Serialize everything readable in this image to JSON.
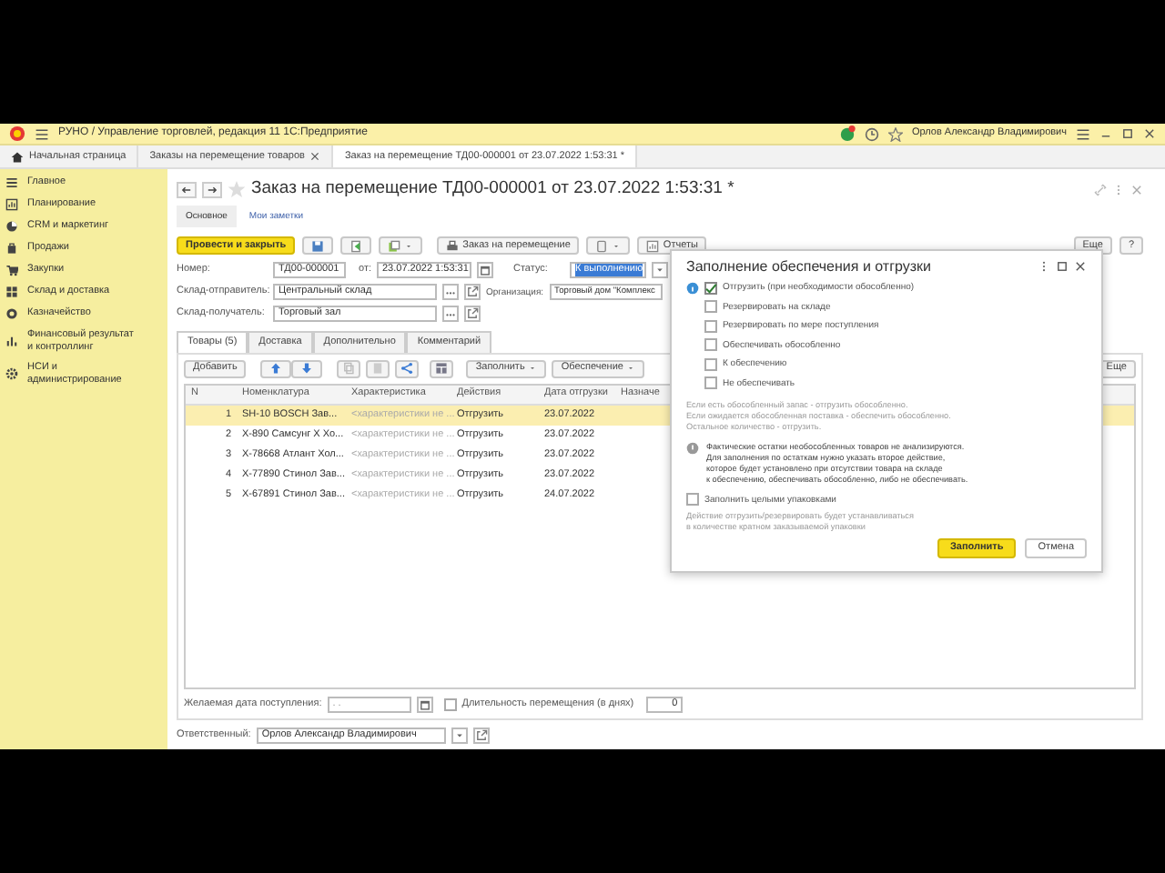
{
  "app_title": "РУНО / Управление торговлей, редакция 11 1С:Предприятие",
  "user": "Орлов Александр Владимирович",
  "tabs": [
    {
      "label": "Начальная страница",
      "kind": "home",
      "selected": false,
      "closable": false
    },
    {
      "label": "Заказы на перемещение товаров",
      "kind": "page",
      "selected": false,
      "closable": true
    },
    {
      "label": "Заказ на перемещение ТД00-000001 от 23.07.2022 1:53:31 *",
      "kind": "page",
      "selected": true,
      "closable": false
    }
  ],
  "sidebar": {
    "items": [
      {
        "label": "Главное"
      },
      {
        "label": "Планирование"
      },
      {
        "label": "CRM и маркетинг"
      },
      {
        "label": "Продажи"
      },
      {
        "label": "Закупки"
      },
      {
        "label": "Склад и доставка"
      },
      {
        "label": "Казначейство"
      },
      {
        "label": "Финансовый результат и контроллинг"
      },
      {
        "label": "НСИ и администрирование"
      }
    ]
  },
  "document": {
    "title": "Заказ на перемещение ТД00-000001 от 23.07.2022 1:53:31 *",
    "subtabs": [
      {
        "label": "Основное",
        "selected": true
      },
      {
        "label": "Мои заметки",
        "selected": false
      }
    ],
    "toolbar": {
      "post_button": "Провести и закрыть",
      "print_button": "Заказ на перемещение",
      "reports_button": "Отчеты",
      "more_button": "Еще",
      "help_button": "?"
    },
    "fields": {
      "number_label": "Номер:",
      "number": "ТД00-000001",
      "date_label": "от:",
      "date": "23.07.2022  1:53:31",
      "status_label": "Статус:",
      "status": "К выполнению",
      "sender_label": "Склад-отправитель:",
      "sender": "Центральный склад",
      "org_label": "Организация:",
      "org": "Торговый дом \"Комплекс",
      "receiver_label": "Склад-получатель:",
      "receiver": "Торговый зал"
    },
    "tabs": [
      {
        "label": "Товары (5)",
        "selected": true
      },
      {
        "label": "Доставка",
        "selected": false
      },
      {
        "label": "Дополнительно",
        "selected": false
      },
      {
        "label": "Комментарий",
        "selected": false
      }
    ],
    "table_toolbar": {
      "add_button": "Добавить",
      "fill_button": "Заполнить",
      "supply_button": "Обеспечение",
      "more_button": "Еще"
    },
    "table": {
      "columns": [
        "N",
        "Номенклатура",
        "Характеристика",
        "Действия",
        "Дата отгрузки",
        "Назначе"
      ],
      "rows": [
        {
          "selected": true,
          "cells": [
            "1",
            "SH-10 BOSCH Зав...",
            "<характеристики не ...",
            "Отгрузить",
            "23.07.2022"
          ]
        },
        {
          "selected": false,
          "cells": [
            "2",
            "X-890 Самсунг X Хо...",
            "<характеристики не ...",
            "Отгрузить",
            "23.07.2022"
          ]
        },
        {
          "selected": false,
          "cells": [
            "3",
            "X-78668 Атлант Хол...",
            "<характеристики не ...",
            "Отгрузить",
            "23.07.2022"
          ]
        },
        {
          "selected": false,
          "cells": [
            "4",
            "X-77890 Стинол Зав...",
            "<характеристики не ...",
            "Отгрузить",
            "23.07.2022"
          ]
        },
        {
          "selected": false,
          "cells": [
            "5",
            "X-67891 Стинол Зав...",
            "<характеристики не ...",
            "Отгрузить",
            "24.07.2022"
          ]
        }
      ]
    },
    "footer": {
      "arrival_label": "Желаемая дата поступления:",
      "arrival": ". .",
      "duration_label": "Длительность перемещения (в днях)",
      "duration_checked": false,
      "duration": "0",
      "responsible_label": "Ответственный:",
      "responsible": "Орлов Александр Владимирович"
    }
  },
  "dialog": {
    "title": "Заполнение обеспечения и отгрузки",
    "options": [
      {
        "label": "Отгрузить (при необходимости обособленно)",
        "checked": true
      },
      {
        "label": "Резервировать на складе",
        "checked": false
      },
      {
        "label": "Резервировать по мере поступления",
        "checked": false
      },
      {
        "label": "Обеспечивать обособленно",
        "checked": false
      },
      {
        "label": "К обеспечению",
        "checked": false
      },
      {
        "label": "Не обеспечивать",
        "checked": false
      }
    ],
    "hint": [
      "Если есть обособленный запас - отгрузить обособленно.",
      "Если ожидается обособленная поставка - обеспечить обособленно.",
      "Остальное количество - отгрузить."
    ],
    "warning": [
      "Фактические остатки необособленных товаров не анализируются.",
      "Для заполнения по остаткам нужно указать второе действие,",
      "которое будет установлено при отсутствии товара на складе",
      "к обеспечению, обеспечивать обособленно, либо не обеспечивать."
    ],
    "packs": {
      "label": "Заполнить целыми упаковками",
      "checked": false
    },
    "packs_hint": [
      "Действие отгрузить/резервировать будет устанавливаться",
      "в количестве кратном заказываемой упаковки"
    ],
    "ok_button": "Заполнить",
    "cancel_button": "Отмена"
  }
}
